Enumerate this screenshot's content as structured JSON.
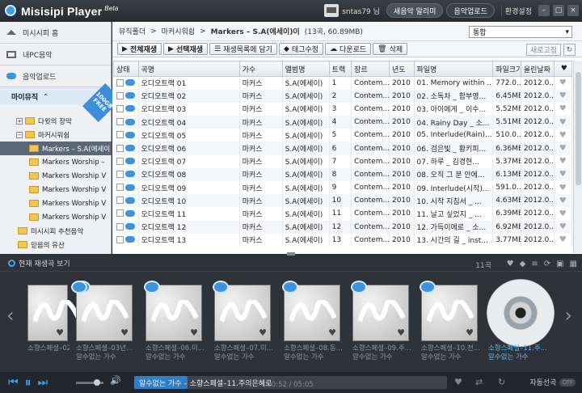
{
  "app": {
    "name": "Misisipi Player",
    "beta": "Beta"
  },
  "titlebar": {
    "username": "sntas79 님",
    "notify": "새음악 알리미",
    "upload": "음악업로드",
    "settings": "환경설정"
  },
  "sidebar": {
    "nav": [
      {
        "label": "미시시피 홈",
        "icon": "home-icon"
      },
      {
        "label": "내PC음악",
        "icon": "pc-icon"
      },
      {
        "label": "음악업로드",
        "icon": "cloud-upload-icon"
      }
    ],
    "my_music": "마이뮤직",
    "badge": "100GB FREE",
    "tree": [
      {
        "label": "다윗의 장막",
        "indent": 1,
        "toggle": "+"
      },
      {
        "label": "마커시워쉽",
        "indent": 1,
        "toggle": "−"
      },
      {
        "label": "Markers – S.A(에세이",
        "indent": 2,
        "selected": true
      },
      {
        "label": "Markers Worship –",
        "indent": 2
      },
      {
        "label": "Markers Worship V",
        "indent": 2
      },
      {
        "label": "Markers Worship V",
        "indent": 2
      },
      {
        "label": "Markers Worship V",
        "indent": 2
      },
      {
        "label": "Markers Worship V",
        "indent": 2
      },
      {
        "label": "미시시피 추천음악",
        "indent": 1
      },
      {
        "label": "믿음의 유산",
        "indent": 1
      }
    ]
  },
  "breadcrumb": {
    "root": "뮤직폴더",
    "parent": "마커시워쉽",
    "current": "Markers – S.A(에세이)이",
    "count": "(13곡, 60.89MB)"
  },
  "sort": {
    "selected": "통합"
  },
  "toolbar": {
    "play_all": "전체재생",
    "play_sel": "선택재생",
    "add_list": "재생목록에 담기",
    "tag_edit": "태그수정",
    "download": "다운로드",
    "delete": "삭제",
    "refresh": "새로고침"
  },
  "table": {
    "headers": [
      "상태",
      "곡명",
      "가수",
      "앨범명",
      "트랙",
      "장르",
      "년도",
      "파일명",
      "파일크기",
      "올린날짜"
    ],
    "rows": [
      [
        "오디오트랙 01",
        "마커스",
        "S.A(에세이)",
        "1",
        "Contem...",
        "2010",
        "01. Memory within ...",
        "772.0...",
        "2012.0..."
      ],
      [
        "오디오트랙 02",
        "마커스",
        "S.A(에세이)",
        "2",
        "Contem...",
        "2010",
        "02. 소독차 _ 함부영...",
        "6.45ME",
        "2012.0..."
      ],
      [
        "오디오트랙 03",
        "마커스",
        "S.A(에세이)",
        "3",
        "Contem...",
        "2010",
        "03. 아이에게 _ 이수...",
        "5.52ME",
        "2012.0..."
      ],
      [
        "오디오트랙 04",
        "마커스",
        "S.A(에세이)",
        "4",
        "Contem...",
        "2010",
        "04. Rainy Day _ 소...",
        "5.51ME",
        "2012.0..."
      ],
      [
        "오디오트랙 05",
        "마커스",
        "S.A(에세이)",
        "5",
        "Contem...",
        "2010",
        "05. Interlude(Rain)...",
        "510.0...",
        "2012.0..."
      ],
      [
        "오디오트랙 06",
        "마커스",
        "S.A(에세이)",
        "6",
        "Contem...",
        "2010",
        "06. 검은빛 _ 황키피...",
        "6.36ME",
        "2012.0..."
      ],
      [
        "오디오트랙 07",
        "마커스",
        "S.A(에세이)",
        "7",
        "Contem...",
        "2010",
        "07. 하루 _ 김경현...",
        "5.37ME",
        "2012.0..."
      ],
      [
        "오디오트랙 08",
        "마커스",
        "S.A(에세이)",
        "8",
        "Contem...",
        "2010",
        "08. 오직 그 분 안에...",
        "6.13ME",
        "2012.0..."
      ],
      [
        "오디오트랙 09",
        "마커스",
        "S.A(에세이)",
        "9",
        "Contem...",
        "2010",
        "09. Interlude(시작)...",
        "591.0...",
        "2012.0..."
      ],
      [
        "오디오트랙 10",
        "마커스",
        "S.A(에세이)",
        "10",
        "Contem...",
        "2010",
        "10. 시작 지침서 _ ...",
        "4.63ME",
        "2012.0..."
      ],
      [
        "오디오트랙 11",
        "마커스",
        "S.A(에세이)",
        "11",
        "Contem...",
        "2010",
        "11. 날고 싶었지 _ ...",
        "6.39ME",
        "2012.0..."
      ],
      [
        "오디오트랙 12",
        "마커스",
        "S.A(에세이)",
        "12",
        "Contem...",
        "2010",
        "12. 가득이에로 _ 소...",
        "6.92ME",
        "2012.0..."
      ],
      [
        "오디오트랙 13",
        "마커스",
        "S.A(에세이)",
        "13",
        "Contem...",
        "2010",
        "13. 시간의 길 _ inst...",
        "3.77ME",
        "2012.0..."
      ]
    ]
  },
  "now_playing": {
    "header": "현재 재생곡 보기",
    "count": "11곡",
    "albums": [
      {
        "l1": "소향스페셜–02선...",
        "l2": ""
      },
      {
        "l1": "소향스페셜–03년...",
        "l2": "알수없는 가수"
      },
      {
        "l1": "소향스페셜–06.미...",
        "l2": "알수없는 가수"
      },
      {
        "l1": "소향스페셜–07.미...",
        "l2": "알수없는 가수"
      },
      {
        "l1": "소향스페셜–08.동...",
        "l2": "알수없는 가수"
      },
      {
        "l1": "소향스페셜–09.주...",
        "l2": "알수없는 가수"
      },
      {
        "l1": "소향스페셜–10.천...",
        "l2": "알수없는 가수"
      }
    ],
    "current": {
      "l1": "소향스페셜–11.주...",
      "l2": "알수없는 가수"
    }
  },
  "player": {
    "track": "알수없는 가수 – 소향스페셜–11.주의은혜로",
    "time": "00:52 / 05:05",
    "progress": 0.17,
    "volume": 0.75,
    "auto_label": "자동선곡",
    "auto_state": "OFF"
  }
}
